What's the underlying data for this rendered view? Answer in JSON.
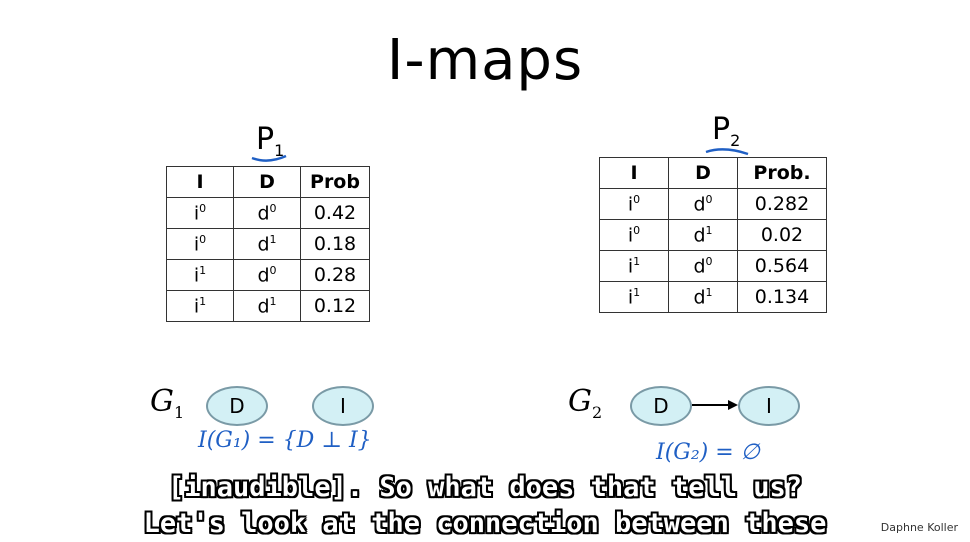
{
  "slide": {
    "title": "I-maps"
  },
  "p1": {
    "name": "P",
    "sub": "1",
    "headers": [
      "I",
      "D",
      "Prob"
    ],
    "rows": [
      {
        "i": "i",
        "i_sup": "0",
        "d": "d",
        "d_sup": "0",
        "prob": "0.42"
      },
      {
        "i": "i",
        "i_sup": "0",
        "d": "d",
        "d_sup": "1",
        "prob": "0.18"
      },
      {
        "i": "i",
        "i_sup": "1",
        "d": "d",
        "d_sup": "0",
        "prob": "0.28"
      },
      {
        "i": "i",
        "i_sup": "1",
        "d": "d",
        "d_sup": "1",
        "prob": "0.12"
      }
    ]
  },
  "p2": {
    "name": "P",
    "sub": "2",
    "headers": [
      "I",
      "D",
      "Prob."
    ],
    "rows": [
      {
        "i": "i",
        "i_sup": "0",
        "d": "d",
        "d_sup": "0",
        "prob": "0.282"
      },
      {
        "i": "i",
        "i_sup": "0",
        "d": "d",
        "d_sup": "1",
        "prob": "0.02"
      },
      {
        "i": "i",
        "i_sup": "1",
        "d": "d",
        "d_sup": "0",
        "prob": "0.564"
      },
      {
        "i": "i",
        "i_sup": "1",
        "d": "d",
        "d_sup": "1",
        "prob": "0.134"
      }
    ]
  },
  "g1": {
    "name": "G",
    "sub": "1",
    "node_d": "D",
    "node_i": "I",
    "annotation": "I(G₁) = {D ⊥ I}"
  },
  "g2": {
    "name": "G",
    "sub": "2",
    "node_d": "D",
    "node_i": "I",
    "annotation": "I(G₂) = ∅"
  },
  "captions": {
    "line1": "[inaudible]. So what does that tell us?",
    "line2": "Let's look at the connection between these"
  },
  "author": "Daphne Koller",
  "colors": {
    "node_fill": "#d3f0f5",
    "ink_blue": "#1f5fc4"
  }
}
